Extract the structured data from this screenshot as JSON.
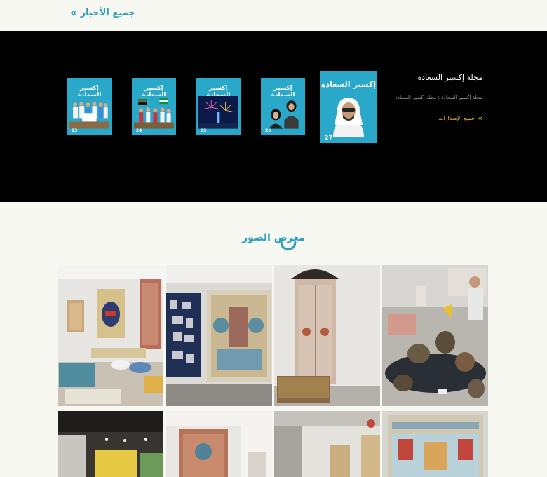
{
  "news": {
    "all_news_label": "جميع الأخبار",
    "chevron": "»"
  },
  "magazine": {
    "title": "مجلة إكسير السعادة",
    "subtitle": "مجلة إكسير السعادة : مجلة إكسير السعادة",
    "all_issues_label": "جميع الإصدارات",
    "chevron": "»",
    "masthead": "إكسير السعادة",
    "issues": [
      {
        "number": "27"
      },
      {
        "number": "26"
      },
      {
        "number": "25"
      },
      {
        "number": "24"
      },
      {
        "number": "23"
      }
    ]
  },
  "gallery": {
    "title": "معرض الصور",
    "images": [
      {
        "name": "gallery-image-1"
      },
      {
        "name": "gallery-image-2"
      },
      {
        "name": "gallery-image-3"
      },
      {
        "name": "gallery-image-4"
      },
      {
        "name": "gallery-image-5"
      },
      {
        "name": "gallery-image-6"
      },
      {
        "name": "gallery-image-7"
      },
      {
        "name": "gallery-image-8"
      }
    ]
  },
  "colors": {
    "accent": "#2a9fbc",
    "gold": "#e2b53a",
    "band": "#000000",
    "page": "#f8f8f2",
    "cover": "#2aa8c9"
  }
}
